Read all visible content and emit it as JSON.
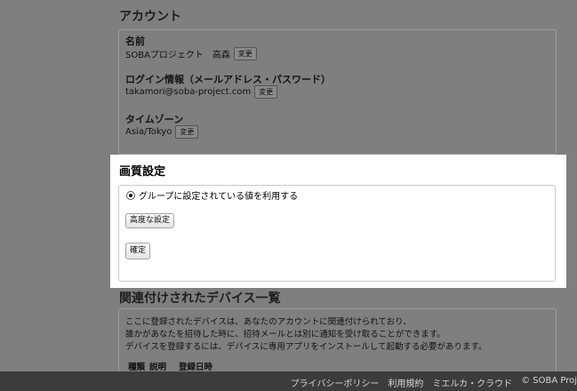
{
  "account": {
    "title": "アカウント",
    "name_label": "名前",
    "name_value": "SOBAプロジェクト　高森",
    "login_label": "ログイン情報（メールアドレス・パスワード）",
    "login_value": "takamori@soba-project.com",
    "timezone_label": "タイムゾーン",
    "timezone_value": "Asia/Tokyo",
    "change_label": "変更"
  },
  "quality": {
    "title": "画質設定",
    "radio_label": "グループに設定されている値を利用する",
    "advanced_button": "高度な設定",
    "confirm_button": "確定"
  },
  "devices": {
    "title": "関連付けされたデバイス一覧",
    "desc_lines": [
      "ここに登録されたデバイスは、あなたのアカウントに関連付けられており、",
      "誰かがあなたを招待した時に、招待メールとは別に通知を受け取ることができます。",
      "デバイスを登録するには、デバイスに専用アプリをインストールして起動する必要があります。"
    ],
    "columns": [
      "種類",
      "説明",
      "登録日時"
    ]
  },
  "footer": {
    "privacy": "プライバシーポリシー",
    "terms": "利用規約",
    "cloud": "ミエルカ・クラウド",
    "copyright": "© SOBA Proj"
  }
}
